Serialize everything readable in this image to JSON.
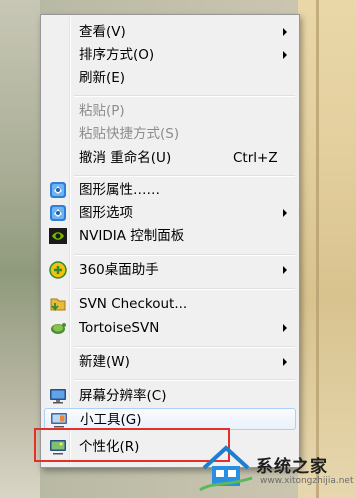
{
  "menu": {
    "items": [
      {
        "label": "查看(V)",
        "submenu": true
      },
      {
        "label": "排序方式(O)",
        "submenu": true
      },
      {
        "label": "刷新(E)"
      },
      {
        "label": "粘贴(P)",
        "disabled": true
      },
      {
        "label": "粘贴快捷方式(S)",
        "disabled": true
      },
      {
        "label": "撤消 重命名(U)",
        "shortcut": "Ctrl+Z"
      },
      {
        "label": "图形属性……",
        "icon": "intel-graphics-icon"
      },
      {
        "label": "图形选项",
        "icon": "intel-graphics-icon",
        "submenu": true
      },
      {
        "label": "NVIDIA 控制面板",
        "icon": "nvidia-icon"
      },
      {
        "label": "360桌面助手",
        "icon": "360-icon",
        "submenu": true
      },
      {
        "label": "SVN Checkout...",
        "icon": "svn-checkout-icon"
      },
      {
        "label": "TortoiseSVN",
        "icon": "tortoisesvn-icon",
        "submenu": true
      },
      {
        "label": "新建(W)",
        "submenu": true
      },
      {
        "label": "屏幕分辨率(C)",
        "icon": "monitor-icon"
      },
      {
        "label": "小工具(G)",
        "icon": "gadgets-icon"
      },
      {
        "label": "个性化(R)",
        "icon": "personalize-icon"
      }
    ]
  },
  "watermark": {
    "text": "系统之家",
    "url": "www.xitongzhijia.net"
  },
  "colors": {
    "highlight_border": "#e0312b",
    "menu_bg": "#f0f0f0"
  }
}
